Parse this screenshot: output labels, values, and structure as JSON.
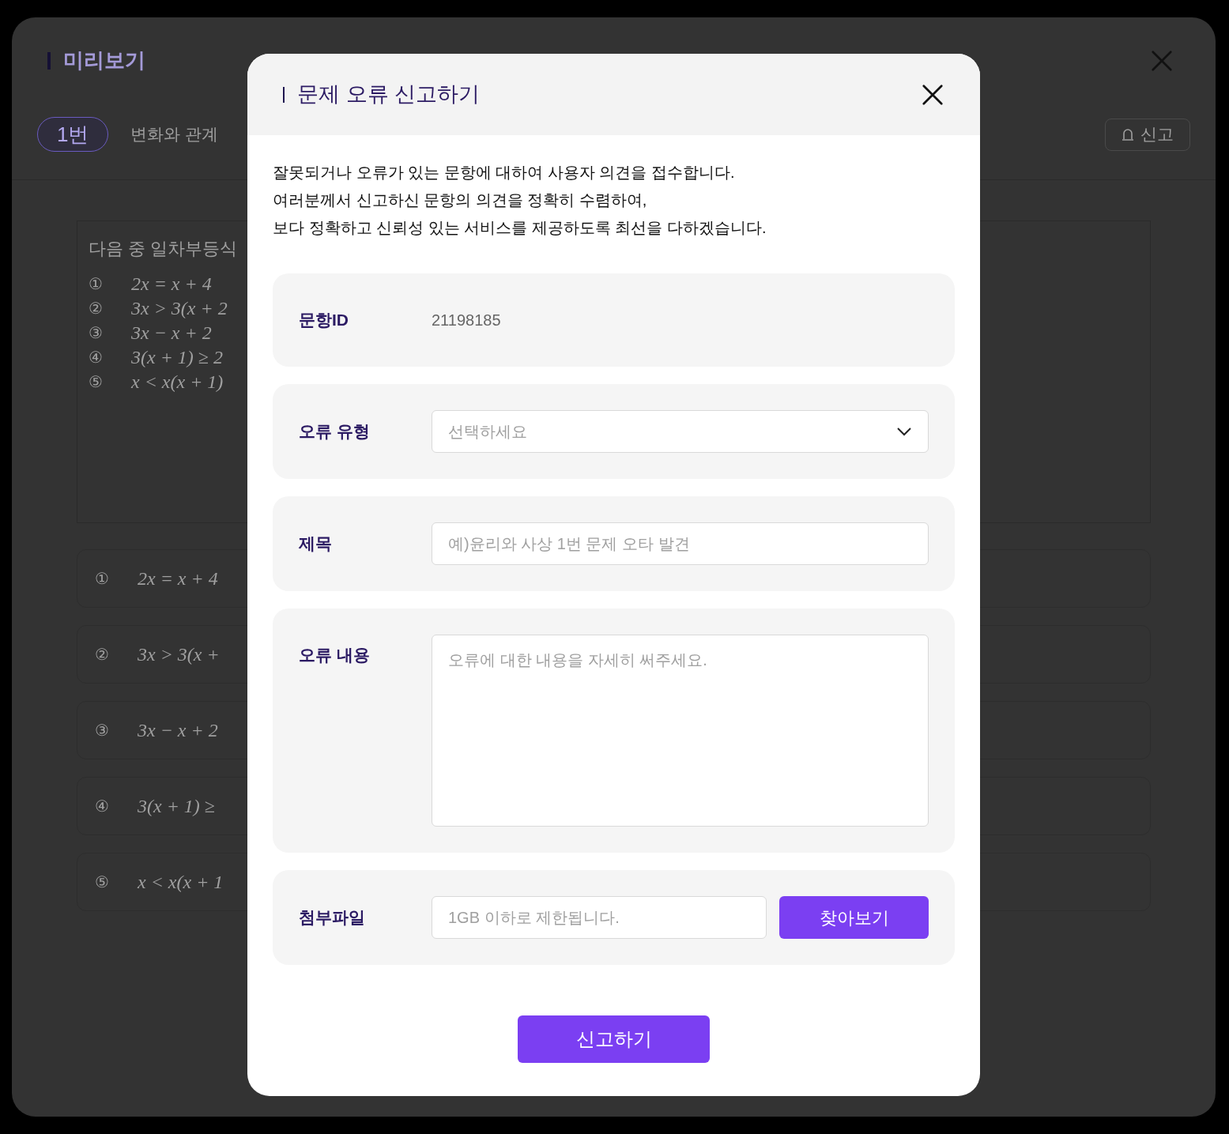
{
  "background": {
    "title": "미리보기",
    "tabs": [
      {
        "label": "1번",
        "selected": true
      },
      {
        "label": "변화와 관계",
        "selected": false
      }
    ],
    "report_button": "신고",
    "question": {
      "prompt": "다음 중 일차부등식",
      "choices": [
        {
          "marker": "①",
          "formula": "2x = x + 4"
        },
        {
          "marker": "②",
          "formula": "3x > 3(x + 2"
        },
        {
          "marker": "③",
          "formula": "3x − x + 2"
        },
        {
          "marker": "④",
          "formula": "3(x + 1) ≥ 2"
        },
        {
          "marker": "⑤",
          "formula": "x < x(x + 1)"
        }
      ]
    },
    "answers": [
      {
        "marker": "①",
        "formula": "2x = x + 4"
      },
      {
        "marker": "②",
        "formula": "3x > 3(x +"
      },
      {
        "marker": "③",
        "formula": "3x − x + 2"
      },
      {
        "marker": "④",
        "formula": "3(x + 1) ≥"
      },
      {
        "marker": "⑤",
        "formula": "x < x(x + 1"
      }
    ]
  },
  "dialog": {
    "title": "문제 오류 신고하기",
    "description": [
      "잘못되거나 오류가 있는 문항에 대하여 사용자 의견을 접수합니다.",
      "여러분께서 신고하신 문항의 의견을 정확히 수렴하여,",
      "보다 정확하고 신뢰성 있는 서비스를 제공하도록 최선을 다하겠습니다."
    ],
    "fields": [
      {
        "kind": "text",
        "label": "문항ID",
        "value": "21198185"
      },
      {
        "kind": "select",
        "label": "오류 유형",
        "placeholder": "선택하세요"
      },
      {
        "kind": "input",
        "label": "제목",
        "placeholder": "예)윤리와 사상 1번 문제 오타 발견"
      },
      {
        "kind": "textarea",
        "label": "오류 내용",
        "placeholder": "오류에 대한 내용을 자세히 써주세요."
      },
      {
        "kind": "file",
        "label": "첨부파일",
        "placeholder": "1GB 이하로 제한됩니다.",
        "button": "찾아보기"
      }
    ],
    "submit": "신고하기"
  }
}
